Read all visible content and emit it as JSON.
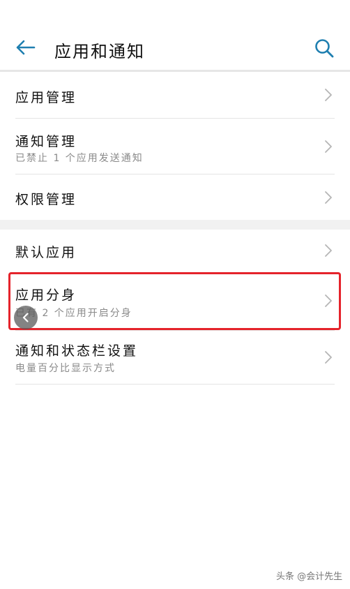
{
  "header": {
    "title": "应用和通知",
    "back_icon": "arrow-left-icon",
    "search_icon": "search-icon",
    "accent_color": "#1f7fb0"
  },
  "groups": [
    {
      "items": [
        {
          "title": "应用管理",
          "subtitle": ""
        },
        {
          "title": "通知管理",
          "subtitle": "已禁止 1 个应用发送通知"
        },
        {
          "title": "权限管理",
          "subtitle": ""
        }
      ]
    },
    {
      "items": [
        {
          "title": "默认应用",
          "subtitle": ""
        },
        {
          "title": "应用分身",
          "subtitle": "已有 2 个应用开启分身"
        },
        {
          "title": "通知和状态栏设置",
          "subtitle": "电量百分比显示方式"
        }
      ]
    }
  ],
  "highlight_color": "#e5232b",
  "watermark": "头条 @会计先生"
}
